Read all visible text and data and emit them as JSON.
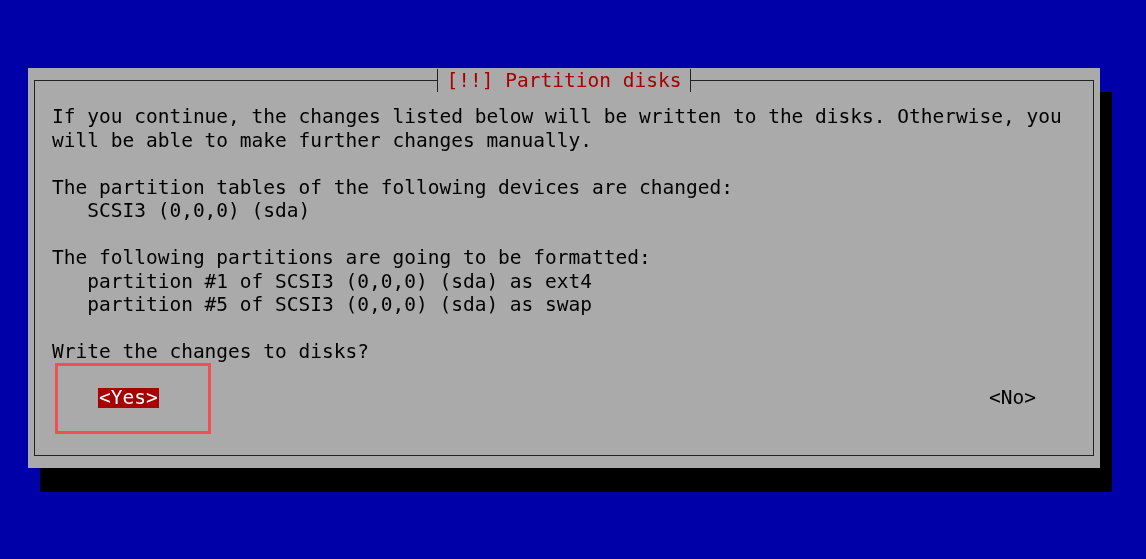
{
  "dialog": {
    "title": "[!!] Partition disks",
    "paragraphs": [
      {
        "text": "If you continue, the changes listed below will be written to the disks. Otherwise, you will be able to make further changes manually."
      },
      {
        "text": "The partition tables of the following devices are changed:",
        "items": [
          "SCSI3 (0,0,0) (sda)"
        ]
      },
      {
        "text": "The following partitions are going to be formatted:",
        "items": [
          "partition #1 of SCSI3 (0,0,0) (sda) as ext4",
          "partition #5 of SCSI3 (0,0,0) (sda) as swap"
        ]
      },
      {
        "text": "Write the changes to disks?"
      }
    ],
    "buttons": [
      {
        "label": "<Yes>",
        "selected": true,
        "highlighted": true
      },
      {
        "label": "<No>",
        "selected": false,
        "highlighted": false
      }
    ]
  }
}
